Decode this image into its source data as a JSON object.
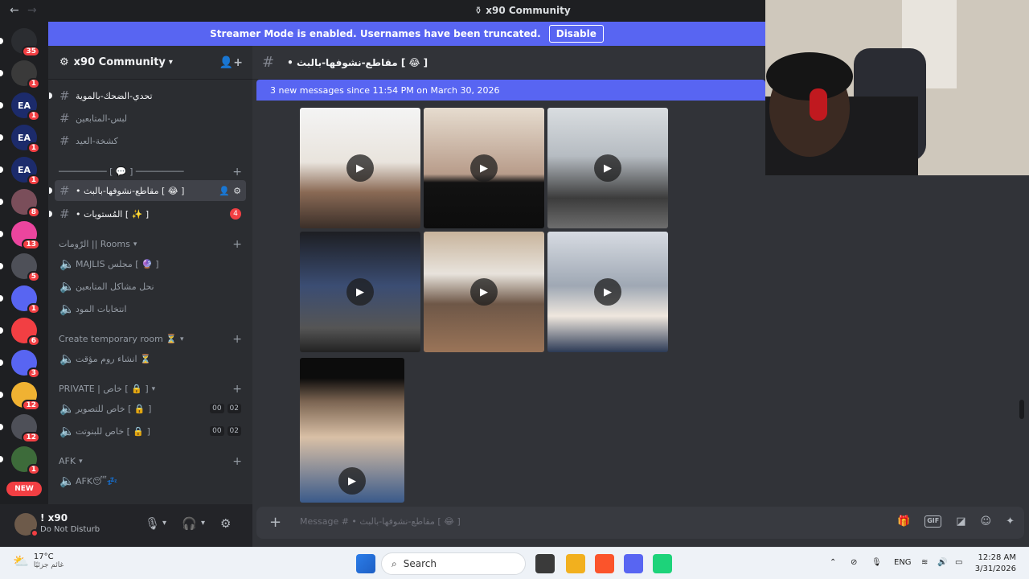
{
  "window": {
    "title": "x90 Community",
    "back_icon": "arrow-left-icon",
    "forward_icon": "arrow-right-icon"
  },
  "streamer_banner": {
    "text": "Streamer Mode is enabled. Usernames have been truncated.",
    "button": "Disable"
  },
  "servers": [
    {
      "badge": "35",
      "color": "#2b2d31"
    },
    {
      "badge": "1",
      "color": "#3a3a3a"
    },
    {
      "badge": "1",
      "color": "#1c2b6b",
      "label": "EA"
    },
    {
      "badge": "1",
      "color": "#1c2b6b",
      "label": "EA"
    },
    {
      "badge": "1",
      "color": "#1c2b6b",
      "label": "EA"
    },
    {
      "badge": "8",
      "color": "#7a4e5a"
    },
    {
      "badge": "13",
      "color": "#eb459e"
    },
    {
      "badge": "5",
      "color": "#4e5058"
    },
    {
      "badge": "1",
      "color": "#5865f2"
    },
    {
      "badge": "6",
      "color": "#f23f43"
    },
    {
      "badge": "3",
      "color": "#5865f2"
    },
    {
      "badge": "12",
      "color": "#f0b232"
    },
    {
      "badge": "12",
      "color": "#4e5058"
    },
    {
      "badge": "1",
      "color": "#3d6b3a"
    }
  ],
  "new_badge": "NEW",
  "guild": {
    "name": "x90 Community",
    "dropdown_icon": "chevron-down-icon",
    "invite_icon": "add-member-icon"
  },
  "channels": {
    "c1": "تحدي-الضحك-بالموية",
    "c2": "لبس-المتابعين",
    "c3": "كشخة-العيد",
    "cat_divider": "───────── [ 💬 ] ─────────",
    "c4": "• مقاطع-نشوفها-بالبث [ 😂 ]",
    "c5": "• المُستويات [ ✨ ]",
    "c5_mentions": "4",
    "cat_rooms": "الرّومات || Rooms",
    "v1": "MAJLIS مجلس [ 🔮 ]",
    "v2": "نحل مشاكل المتابعين",
    "v3": "انتخابات المود",
    "cat_temp": "Create temporary room ⏳",
    "v4": "انشاء روم مؤقت ⏳",
    "cat_private": "PRIVATE | خاص [ 🔒 ]",
    "v5": "خاص للتصوير [ 🔒 ]",
    "v6": "خاص للبنوتت [ 🔒 ]",
    "count_a": "00",
    "count_b": "02",
    "cat_afk": "AFK",
    "v7": "AFK😴💤"
  },
  "user": {
    "name": "! x90",
    "status": "Do Not Disturb",
    "mic_icon": "microphone-icon",
    "headset_icon": "headphones-icon",
    "settings_icon": "gear-icon"
  },
  "chat": {
    "channel_title": "• مقاطع-نشوفها-بالبث [ 😂 ]",
    "new_messages": "3 new messages since 11:54 PM on March 30, 2026",
    "play_icon": "play-icon",
    "composer_placeholder": "Message # • مقاطع-نشوفها-بالبث [ 😂 ]",
    "gif_label": "GIF"
  },
  "taskbar": {
    "temperature": "17°C",
    "weather_desc": "غائم جزئيًا",
    "search": "Search",
    "lang": "ENG",
    "time": "12:28 AM",
    "date": "3/31/2026"
  }
}
